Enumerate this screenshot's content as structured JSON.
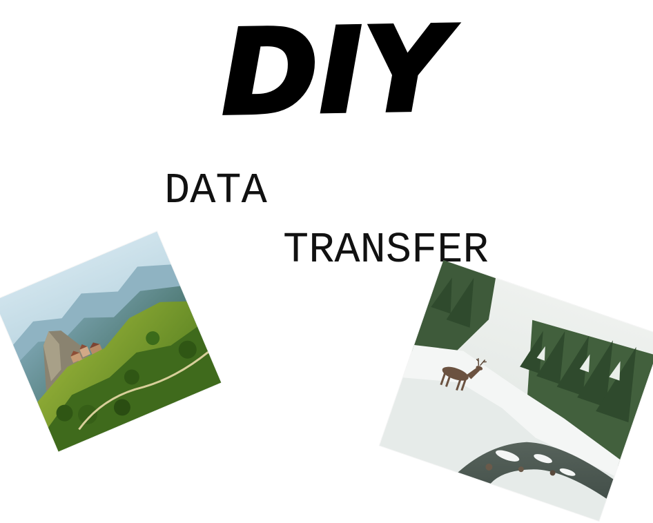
{
  "heading": {
    "title": "DIY",
    "line1": "DATA",
    "line2": "TRANSFER"
  },
  "images": [
    {
      "name": "mountain-village-photo"
    },
    {
      "name": "snowy-forest-deer-photo"
    }
  ],
  "colors": {
    "background": "#ffffff",
    "text": "#000000"
  }
}
